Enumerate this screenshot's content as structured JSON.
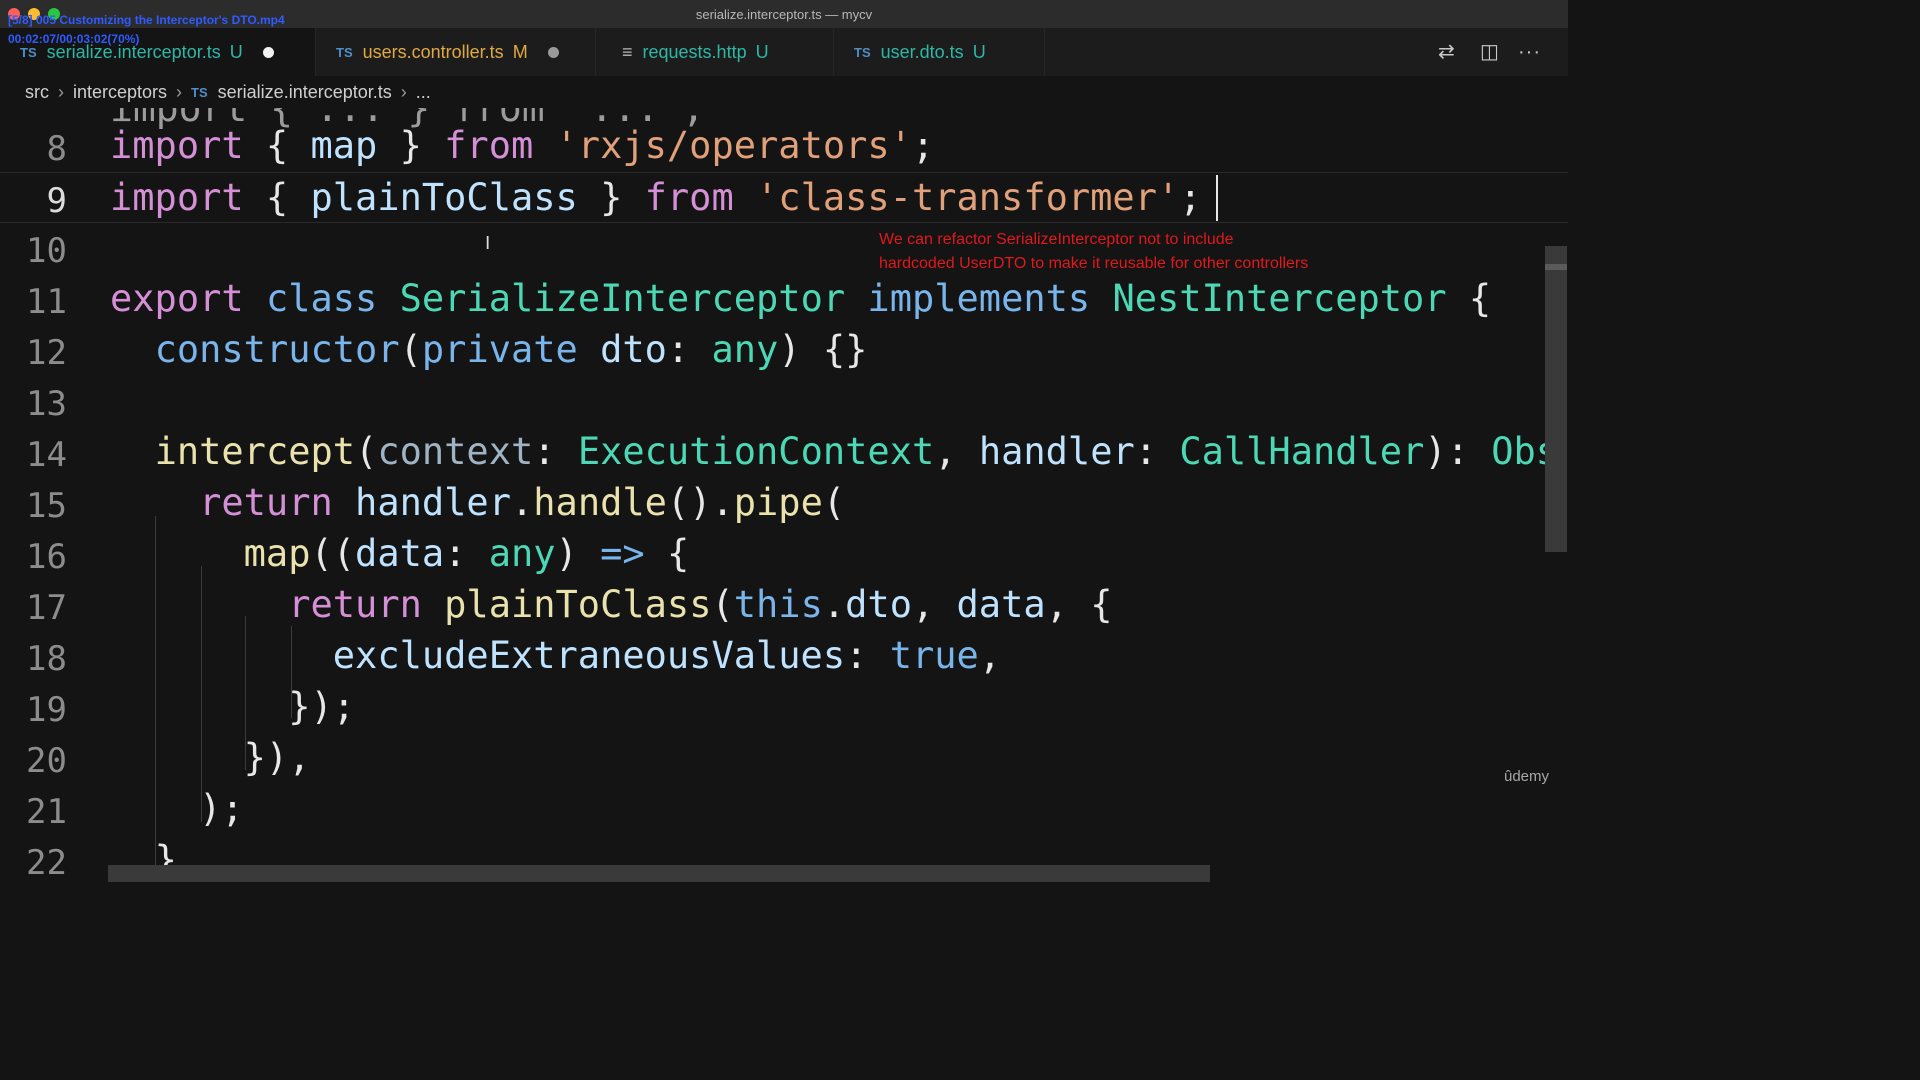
{
  "window": {
    "title": "serialize.interceptor.ts — mycv",
    "player_title": "[5/8] 005 Customizing the Interceptor's DTO.mp4",
    "player_time": "00:02:07/00:03:02(70%)"
  },
  "tabs": [
    {
      "type": "TS",
      "label": "serialize.interceptor.ts",
      "status": "U",
      "dirty": true
    },
    {
      "type": "TS",
      "label": "users.controller.ts",
      "status": "M",
      "dirty": true
    },
    {
      "icon": "≡",
      "label": "requests.http",
      "status": "U"
    },
    {
      "type": "TS",
      "label": "user.dto.ts",
      "status": "U"
    }
  ],
  "toolbar": {
    "compare_icon": "⇄",
    "split_icon": "◫",
    "more_icon": "···"
  },
  "breadcrumb": [
    "src",
    "interceptors",
    "TS",
    "serialize.interceptor.ts",
    "..."
  ],
  "annotation": {
    "line1": "We can refactor SerializeInterceptor not to include",
    "line2": "hardcoded UserDTO to make it reusable for other controllers"
  },
  "watermark": "ûdemy",
  "code": {
    "partial_line": "import { ... } from '...';",
    "line_numbers": [
      "8",
      "9",
      "10",
      "11",
      "12",
      "13",
      "14",
      "15",
      "16",
      "17",
      "18",
      "19",
      "20",
      "21",
      "22"
    ],
    "l8": [
      "import",
      " { ",
      "map",
      " } ",
      "from",
      " ",
      "'rxjs/operators'",
      ";"
    ],
    "l9": [
      "import",
      " { ",
      "plainToClass",
      " } ",
      "from",
      " ",
      "'class-transformer'",
      ";"
    ],
    "l11": [
      "export",
      " ",
      "class",
      " ",
      "SerializeInterceptor",
      " ",
      "implements",
      " ",
      "NestInterceptor",
      " {"
    ],
    "l12": [
      "  ",
      "constructor",
      "(",
      "private",
      " ",
      "dto",
      ": ",
      "any",
      ") {}"
    ],
    "l14": [
      "  ",
      "intercept",
      "(",
      "context",
      ": ",
      "ExecutionContext",
      ", ",
      "handler",
      ": ",
      "CallHandler",
      "): ",
      "Obs"
    ],
    "l15": [
      "    ",
      "return",
      " ",
      "handler",
      ".",
      "handle",
      "().",
      "pipe",
      "("
    ],
    "l16": [
      "      ",
      "map",
      "((",
      "data",
      ": ",
      "any",
      ") ",
      "=>",
      " {"
    ],
    "l17": [
      "        ",
      "return",
      " ",
      "plainToClass",
      "(",
      "this",
      ".",
      "dto",
      ", ",
      "data",
      ", {"
    ],
    "l18": [
      "          ",
      "excludeExtraneousValues",
      ": ",
      "true",
      ","
    ],
    "l19": [
      "        ",
      "});"
    ],
    "l20": [
      "      ",
      "}),"
    ],
    "l21": [
      "    ",
      ");"
    ],
    "l22": [
      "  ",
      "}"
    ]
  },
  "colors": {
    "background": "#141414",
    "keyword": "#d58fd6",
    "string": "#e0a07a",
    "type": "#4cd8b4",
    "variable": "#bfe3ff",
    "annotation": "#e0191c",
    "modified_dot": "#d9d9d9"
  }
}
